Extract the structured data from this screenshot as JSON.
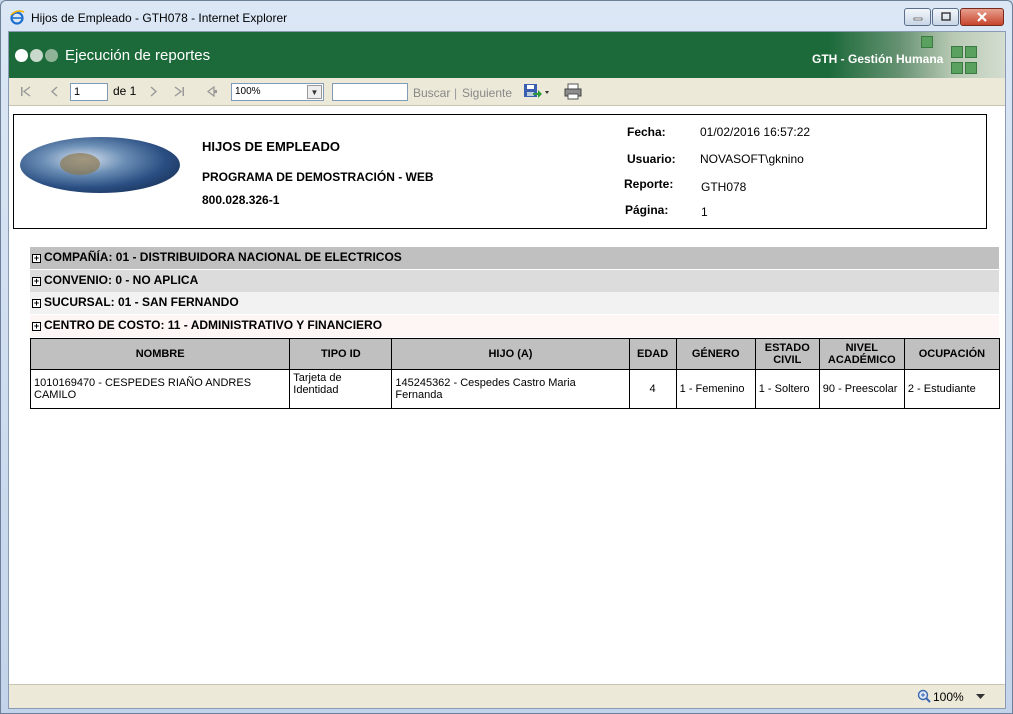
{
  "window": {
    "title": "Hijos de Empleado - GTH078 - Internet Explorer"
  },
  "banner": {
    "title": "Ejecución de reportes",
    "brand": "GTH - Gestión Humana"
  },
  "toolbar": {
    "page_value": "1",
    "page_of": "de 1",
    "zoom_value": "100%",
    "search_value": "",
    "find_label": "Buscar",
    "separator": "|",
    "next_label": "Siguiente"
  },
  "report": {
    "title": "HIJOS DE EMPLEADO",
    "subtitle": "PROGRAMA DE DEMOSTRACIÓN - WEB",
    "nit": "800.028.326-1",
    "meta": {
      "fecha_label": "Fecha:",
      "fecha_value": "01/02/2016 16:57:22",
      "usuario_label": "Usuario:",
      "usuario_value": "NOVASOFT\\gknino",
      "reporte_label": "Reporte:",
      "reporte_value": "GTH078",
      "pagina_label": "Página:",
      "pagina_value": "1"
    },
    "groups": [
      {
        "label": "COMPAÑÍA: 01 - DISTRIBUIDORA NACIONAL DE ELECTRICOS",
        "color": "#c0c0c0"
      },
      {
        "label": "CONVENIO: 0 - NO APLICA",
        "color": "#dcdcdc"
      },
      {
        "label": "SUCURSAL: 01 - SAN FERNANDO",
        "color": "#f2f2f2"
      },
      {
        "label": "CENTRO DE COSTO: 11 - ADMINISTRATIVO Y FINANCIERO",
        "color": "#fdf6f4"
      }
    ],
    "table": {
      "headers": [
        "NOMBRE",
        "TIPO ID",
        "HIJO (A)",
        "EDAD",
        "GÉNERO",
        "ESTADO CIVIL",
        "NIVEL ACADÉMICO",
        "OCUPACIÓN"
      ],
      "rows": [
        [
          "1010169470 - CESPEDES RIAÑO ANDRES CAMILO",
          "Tarjeta de Identidad",
          "145245362 - Cespedes Castro Maria Fernanda",
          "4",
          "1 - Femenino",
          "1 - Soltero",
          "90 - Preescolar",
          "2 - Estudiante"
        ]
      ]
    }
  },
  "status": {
    "zoom": "100%"
  },
  "colors": {
    "banner_green": "#1c6a3a",
    "toolbar_bg": "#ece9d8"
  }
}
